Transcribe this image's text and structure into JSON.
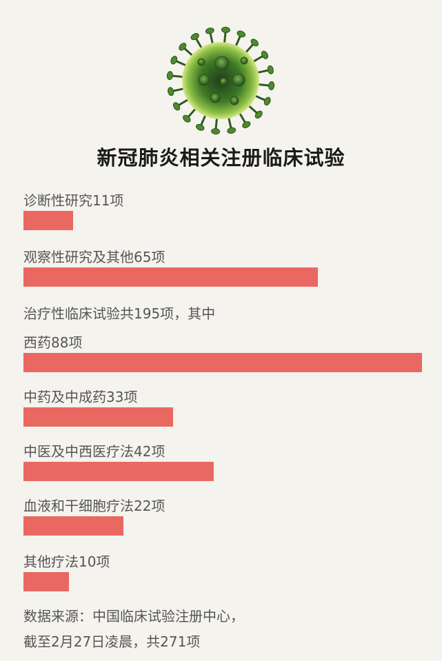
{
  "title": "新冠肺炎相关注册临床试验",
  "chart_data": {
    "type": "bar",
    "orientation": "horizontal",
    "title": "新冠肺炎相关注册临床试验",
    "categories": [
      "诊断性研究",
      "观察性研究及其他",
      "西药",
      "中药及中成药",
      "中医及中西医疗法",
      "血液和干细胞疗法",
      "其他疗法"
    ],
    "values": [
      11,
      65,
      88,
      33,
      42,
      22,
      10
    ],
    "labels": [
      "诊断性研究11项",
      "观察性研究及其他65项",
      "西药88项",
      "中药及中成药33项",
      "中医及中西医疗法42项",
      "血液和干细胞疗法22项",
      "其他疗法10项"
    ],
    "xlim": [
      0,
      88
    ],
    "bar_color": "#e96962"
  },
  "subheading": "治疗性临床试验共195项，其中",
  "source": {
    "line1": "数据来源：中国临床试验注册中心，",
    "line2": "截至2月27日凌晨，共271项"
  }
}
